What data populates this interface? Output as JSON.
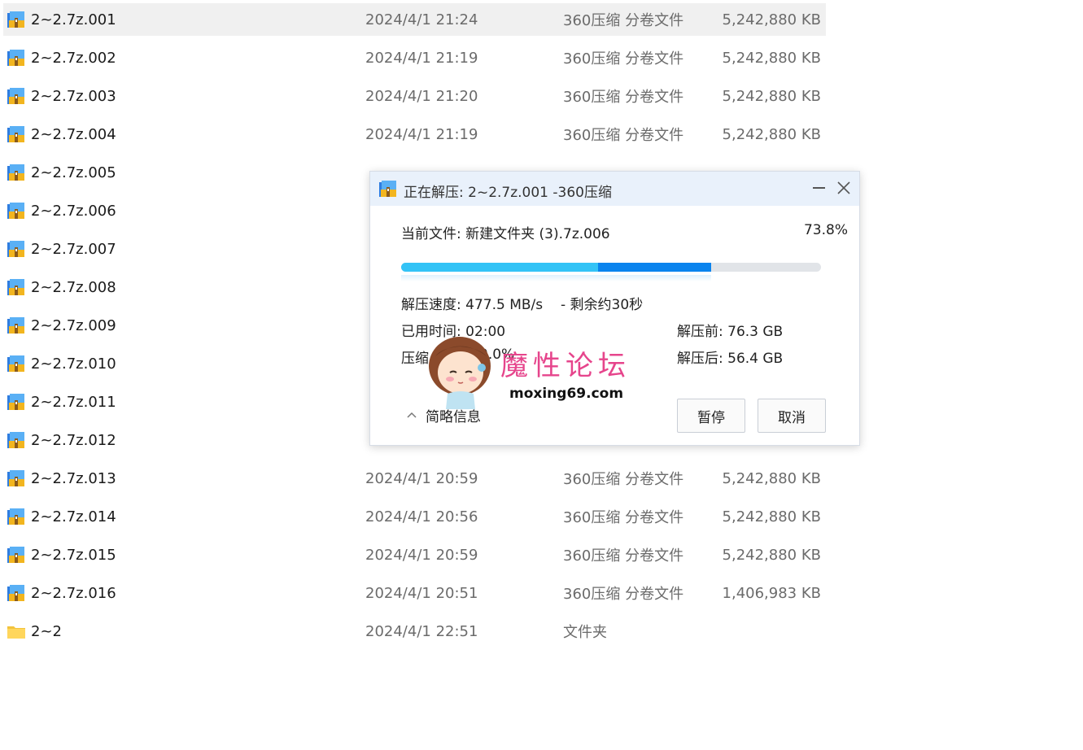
{
  "files": [
    {
      "name": "2~2.7z.001",
      "date": "2024/4/1 21:24",
      "type": "360压缩 分卷文件",
      "size": "5,242,880 KB",
      "icon": "archive-icon",
      "selected": true
    },
    {
      "name": "2~2.7z.002",
      "date": "2024/4/1 21:19",
      "type": "360压缩 分卷文件",
      "size": "5,242,880 KB",
      "icon": "archive-icon"
    },
    {
      "name": "2~2.7z.003",
      "date": "2024/4/1 21:20",
      "type": "360压缩 分卷文件",
      "size": "5,242,880 KB",
      "icon": "archive-icon"
    },
    {
      "name": "2~2.7z.004",
      "date": "2024/4/1 21:19",
      "type": "360压缩 分卷文件",
      "size": "5,242,880 KB",
      "icon": "archive-icon"
    },
    {
      "name": "2~2.7z.005",
      "date": "",
      "type": "",
      "size": "",
      "icon": "archive-icon"
    },
    {
      "name": "2~2.7z.006",
      "date": "",
      "type": "",
      "size": "",
      "icon": "archive-icon"
    },
    {
      "name": "2~2.7z.007",
      "date": "",
      "type": "",
      "size": "",
      "icon": "archive-icon"
    },
    {
      "name": "2~2.7z.008",
      "date": "",
      "type": "",
      "size": "",
      "icon": "archive-icon"
    },
    {
      "name": "2~2.7z.009",
      "date": "",
      "type": "",
      "size": "",
      "icon": "archive-icon"
    },
    {
      "name": "2~2.7z.010",
      "date": "",
      "type": "",
      "size": "",
      "icon": "archive-icon"
    },
    {
      "name": "2~2.7z.011",
      "date": "",
      "type": "",
      "size": "",
      "icon": "archive-icon"
    },
    {
      "name": "2~2.7z.012",
      "date": "",
      "type": "",
      "size": "",
      "icon": "archive-icon"
    },
    {
      "name": "2~2.7z.013",
      "date": "2024/4/1 20:59",
      "type": "360压缩 分卷文件",
      "size": "5,242,880 KB",
      "icon": "archive-icon"
    },
    {
      "name": "2~2.7z.014",
      "date": "2024/4/1 20:56",
      "type": "360压缩 分卷文件",
      "size": "5,242,880 KB",
      "icon": "archive-icon"
    },
    {
      "name": "2~2.7z.015",
      "date": "2024/4/1 20:59",
      "type": "360压缩 分卷文件",
      "size": "5,242,880 KB",
      "icon": "archive-icon"
    },
    {
      "name": "2~2.7z.016",
      "date": "2024/4/1 20:51",
      "type": "360压缩 分卷文件",
      "size": "1,406,983 KB",
      "icon": "archive-icon"
    },
    {
      "name": "2~2",
      "date": "2024/4/1 22:51",
      "type": "文件夹",
      "size": "",
      "icon": "folder-icon"
    }
  ],
  "dialog": {
    "title": "正在解压: 2~2.7z.001 -360压缩",
    "current_file": "当前文件: 新建文件夹 (3).7z.006",
    "percent": "73.8%",
    "progress": {
      "overall": 0.738,
      "secondary_start": 0.469
    },
    "speed": "解压速度: 477.5 MB/s",
    "remaining": "- 剩余约30秒",
    "elapsed": "已用时间: 02:00",
    "ratio_label": "压缩",
    "ratio_value": "0.0%",
    "before": "解压前: 76.3 GB",
    "after": "解压后: 56.4 GB",
    "details_label": "简略信息",
    "pause_label": "暂停",
    "cancel_label": "取消"
  },
  "watermark": {
    "logo_text": "魔性论坛",
    "url": "moxing69.com"
  },
  "colors": {
    "progress_light": "#33c3f6",
    "progress_dark": "#0a84ee",
    "watermark_pink": "#e6458c"
  }
}
